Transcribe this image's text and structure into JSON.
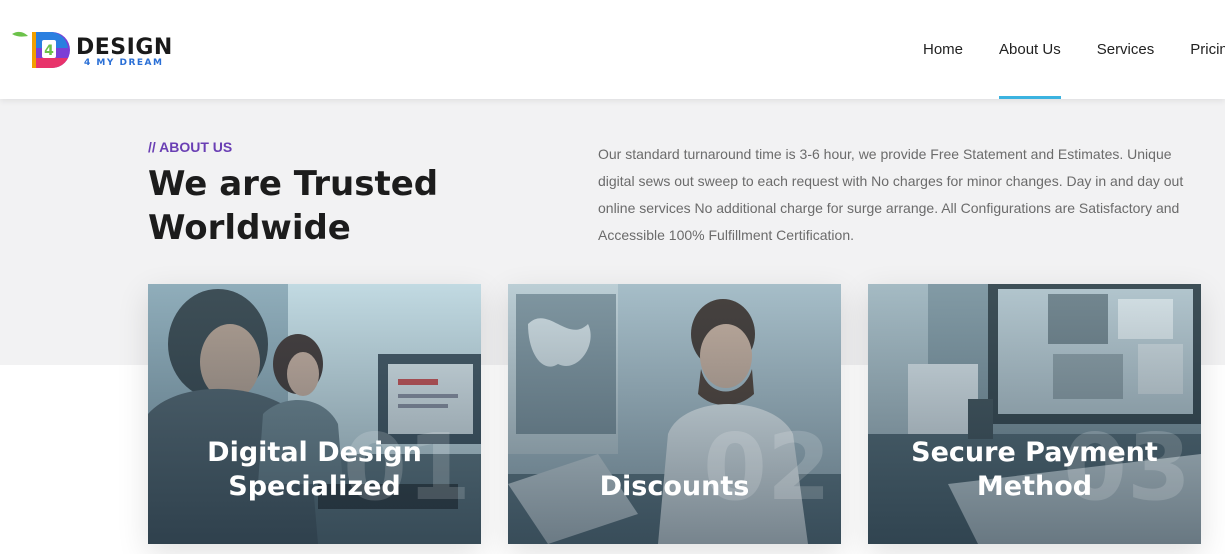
{
  "brand": {
    "name": "DESIGN",
    "tagline": "4 MY DREAM",
    "mark": "4"
  },
  "nav": {
    "items": [
      "Home",
      "About Us",
      "Services",
      "Pricing"
    ],
    "active": "About Us"
  },
  "about": {
    "eyebrow": "// ABOUT US",
    "headline": "We are Trusted Worldwide",
    "description": "Our standard turnaround time is 3-6 hour, we provide Free Statement and Estimates. Unique digital sews out sweep to each request with No charges for minor changes. Day in and day out online services No additional charge for surge arrange. All Configurations are Satisfactory and Accessible 100% Fulfillment Certification."
  },
  "cards": [
    {
      "title": "Digital Design Specialized",
      "number": "01"
    },
    {
      "title": "Discounts",
      "number": "02"
    },
    {
      "title": "Secure Payment Method",
      "number": "03"
    }
  ],
  "colors": {
    "accent": "#3bb3e0",
    "eyebrow": "#6a3fb4",
    "hero_bg": "#f2f2f3"
  }
}
